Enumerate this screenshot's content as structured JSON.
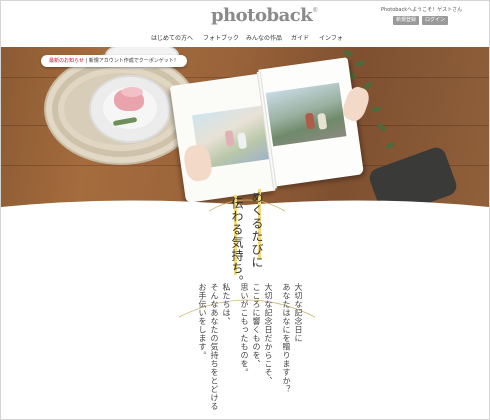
{
  "header": {
    "logo": "photoback",
    "logo_mark": "®",
    "welcome": "Photobackへようこそ！ゲストさん",
    "register_label": "新規登録",
    "login_label": "ログイン"
  },
  "nav": {
    "items": [
      "はじめての方へ",
      "フォトブック",
      "みんなの作品",
      "ガイド",
      "インフォ"
    ]
  },
  "hero": {
    "news_label": "最新のお知らせ",
    "news_sep": "|",
    "news_text": "新規アカウント作成でクーポンゲット！"
  },
  "lower": {
    "title_lines": [
      "めくるたびに",
      "伝わる気持ち。"
    ],
    "body_lines": [
      "大切な記念日に",
      "あなたはなにを贈りますか？",
      "大切な記念日だからこそ、",
      "こころに響くものを、",
      "思いがこもったものを。",
      "私たちは、",
      "そんなあなたの気持ちをとどける",
      "お手伝いをします。"
    ]
  },
  "colors": {
    "accent_highlight": "#f0dc7a",
    "button_gray": "#9a9a9a",
    "news_red": "#c8102e",
    "wood": "#9a633a"
  }
}
